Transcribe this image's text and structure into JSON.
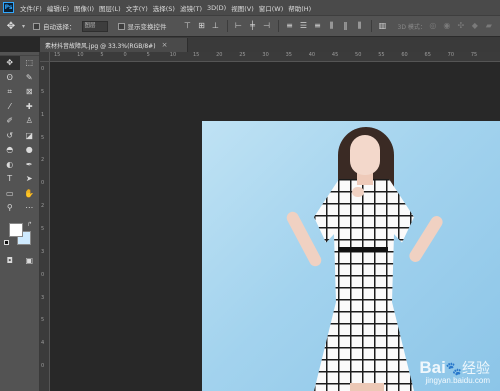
{
  "app": {
    "logo": "Ps"
  },
  "menu": {
    "items": [
      "文件(F)",
      "编辑(E)",
      "图像(I)",
      "图层(L)",
      "文字(Y)",
      "选择(S)",
      "滤镜(T)",
      "3D(D)",
      "视图(V)",
      "窗口(W)",
      "帮助(H)"
    ]
  },
  "options": {
    "auto_select_label": "自动选择：",
    "auto_select_value": "图层",
    "show_transform_label": "显示变换控件",
    "mode_3d": "3D 模式："
  },
  "document": {
    "tab_title": "素材抖音故障风.jpg @ 33.3%(RGB/8#)",
    "close": "×"
  },
  "ruler": {
    "h_labels": [
      "15",
      "10",
      "5",
      "0",
      "5",
      "10",
      "15",
      "20",
      "25",
      "30",
      "35",
      "40",
      "45",
      "50",
      "55",
      "60",
      "65",
      "70",
      "75"
    ],
    "v_labels": [
      "0",
      "5",
      "1",
      "5",
      "2",
      "0",
      "2",
      "5",
      "3",
      "0",
      "3",
      "5",
      "4",
      "0"
    ]
  },
  "colors": {
    "foreground": "#ffffff",
    "background": "#cfeafe",
    "accent": "#31a8ff"
  },
  "watermark": {
    "brand": "Bai",
    "paw": "🐾",
    "brand_suffix": "经验",
    "url": "jingyan.baidu.com"
  },
  "icons": [
    "move-icon",
    "marquee-icon",
    "lasso-icon",
    "quick-select-icon",
    "crop-icon",
    "frame-icon",
    "eyedropper-icon",
    "healing-icon",
    "brush-icon",
    "stamp-icon",
    "history-brush-icon",
    "eraser-icon",
    "bucket-icon",
    "blur-icon",
    "dodge-icon",
    "pen-icon",
    "type-icon",
    "path-select-icon",
    "shape-icon",
    "hand-icon",
    "zoom-icon",
    "more-icon",
    "quick-mask-icon",
    "screen-mode-icon"
  ]
}
